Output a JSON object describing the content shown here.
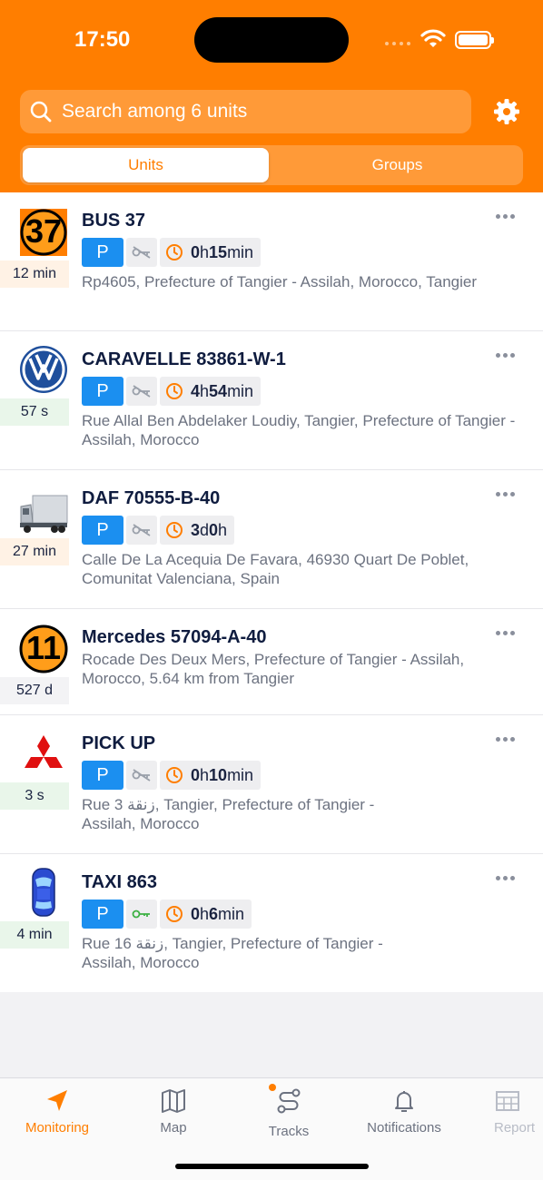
{
  "status_bar": {
    "time": "17:50"
  },
  "search": {
    "placeholder": "Search among 6 units"
  },
  "segments": {
    "units": "Units",
    "groups": "Groups"
  },
  "units": [
    {
      "name": "BUS 37",
      "thumb_label": "37",
      "ago": "12 min",
      "parking": "P",
      "duration_a": "0",
      "duration_a_unit": "h ",
      "duration_b": "15",
      "duration_b_unit": "min",
      "address": "Rp4605, Prefecture of Tangier - Assilah, Morocco, Tangier"
    },
    {
      "name": "CARAVELLE 83861-W-1",
      "thumb_icon": "volkswagen-logo-icon",
      "ago": "57 s",
      "parking": "P",
      "duration_a": "4",
      "duration_a_unit": "h ",
      "duration_b": "54",
      "duration_b_unit": "min",
      "address": "Rue Allal Ben Abdelaker Loudiy, Tangier, Prefecture of Tangier - Assilah, Morocco"
    },
    {
      "name": "DAF 70555-B-40",
      "thumb_icon": "truck-icon",
      "ago": "27 min",
      "parking": "P",
      "duration_a": "3",
      "duration_a_unit": "d ",
      "duration_b": "0",
      "duration_b_unit": "h",
      "address": "Calle De La Acequia De Favara, 46930 Quart De Poblet, Comunitat Valenciana, Spain"
    },
    {
      "name": "Mercedes 57094-A-40",
      "thumb_label": "11",
      "ago": "527 d",
      "address": "Rocade Des Deux Mers, Prefecture of Tangier - Assilah, Morocco, 5.64 km from Tangier"
    },
    {
      "name": "PICK UP",
      "thumb_icon": "mitsubishi-logo-icon",
      "ago": "3 s",
      "parking": "P",
      "duration_a": "0",
      "duration_a_unit": "h ",
      "duration_b": "10",
      "duration_b_unit": "min",
      "address": "Rue 3 زنقة, Tangier, Prefecture of Tangier - Assilah, Morocco"
    },
    {
      "name": "TAXI 863",
      "thumb_icon": "car-top-view-icon",
      "ago": "4 min",
      "parking": "P",
      "duration_a": "0",
      "duration_a_unit": "h ",
      "duration_b": "6",
      "duration_b_unit": "min",
      "address": "Rue 16 زنقة, Tangier, Prefecture of Tangier - Assilah, Morocco"
    }
  ],
  "tabbar": {
    "monitoring": "Monitoring",
    "map": "Map",
    "tracks": "Tracks",
    "notifications": "Notifications",
    "reports": "Report"
  },
  "colors": {
    "accent": "#ff7e00",
    "parking_blue": "#1b8ff0",
    "ignition_on": "#3cb043"
  }
}
